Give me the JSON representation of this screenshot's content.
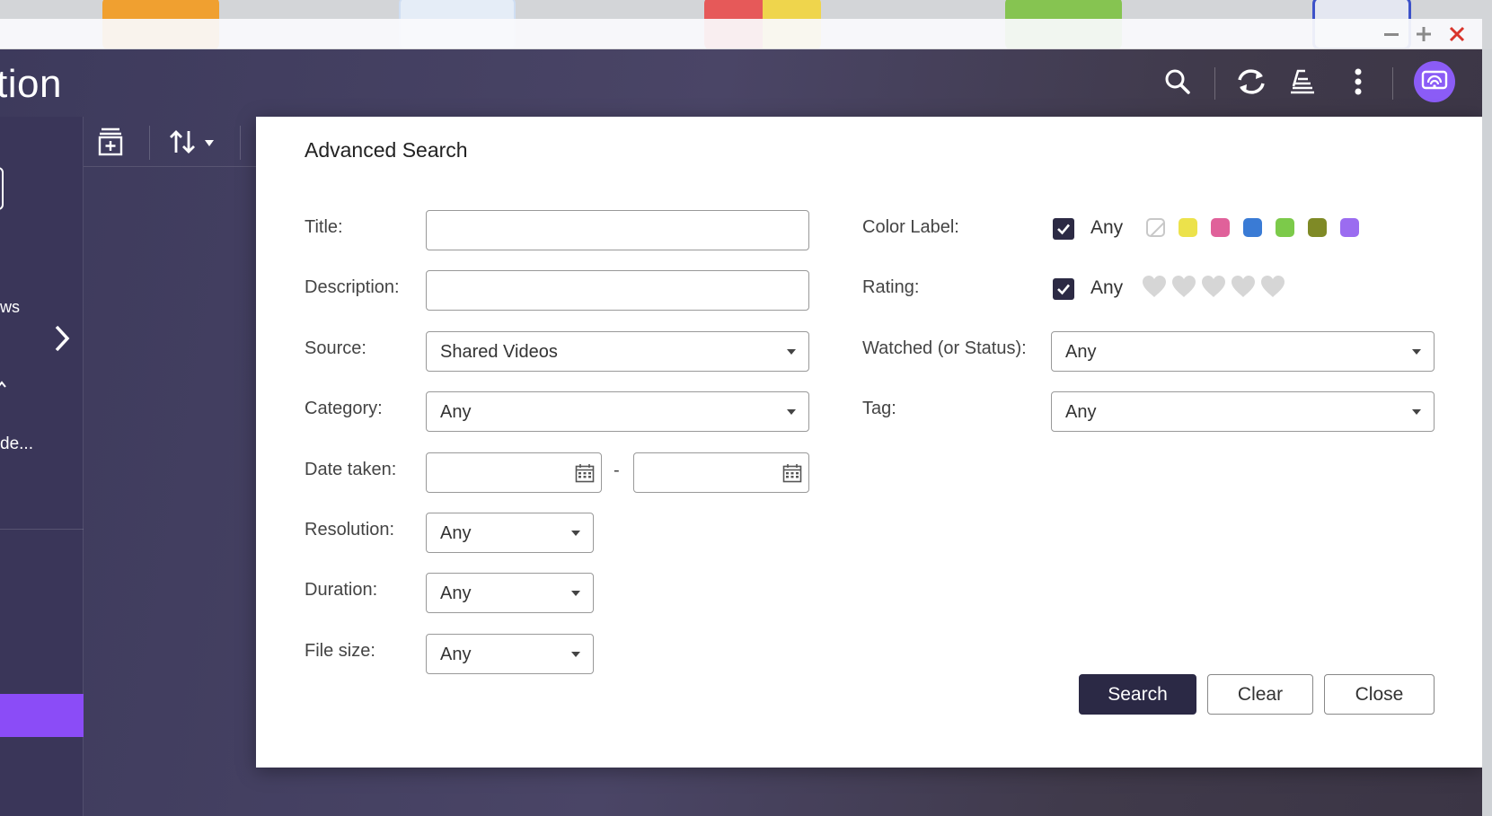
{
  "app": {
    "title_fragment": "tion"
  },
  "sidebar": {
    "items": [
      {
        "label": "ws"
      },
      {
        "label": "de..."
      }
    ]
  },
  "dialog": {
    "title": "Advanced Search",
    "fields": {
      "title": {
        "label": "Title:",
        "value": ""
      },
      "description": {
        "label": "Description:",
        "value": ""
      },
      "source": {
        "label": "Source:",
        "value": "Shared Videos"
      },
      "category": {
        "label": "Category:",
        "value": "Any"
      },
      "date_taken": {
        "label": "Date taken:",
        "from": "",
        "to": "",
        "separator": "-"
      },
      "resolution": {
        "label": "Resolution:",
        "value": "Any"
      },
      "duration": {
        "label": "Duration:",
        "value": "Any"
      },
      "file_size": {
        "label": "File size:",
        "value": "Any"
      },
      "color_label": {
        "label": "Color Label:",
        "any_checked": true,
        "any_label": "Any",
        "colors": [
          "none",
          "#ece24b",
          "#e0619a",
          "#3a7bd5",
          "#7cca4a",
          "#7f8a26",
          "#9b6cf0"
        ]
      },
      "rating": {
        "label": "Rating:",
        "any_checked": true,
        "any_label": "Any",
        "stars": 5,
        "selected": 0
      },
      "watched": {
        "label": "Watched (or Status):",
        "value": "Any"
      },
      "tag": {
        "label": "Tag:",
        "value": "Any"
      }
    },
    "buttons": {
      "search": "Search",
      "clear": "Clear",
      "close": "Close"
    }
  },
  "colors": {
    "accent": "#8b4cf7",
    "primary_button": "#2b2945",
    "checkbox": "#2c2a44",
    "close_x": "#d9342b"
  }
}
